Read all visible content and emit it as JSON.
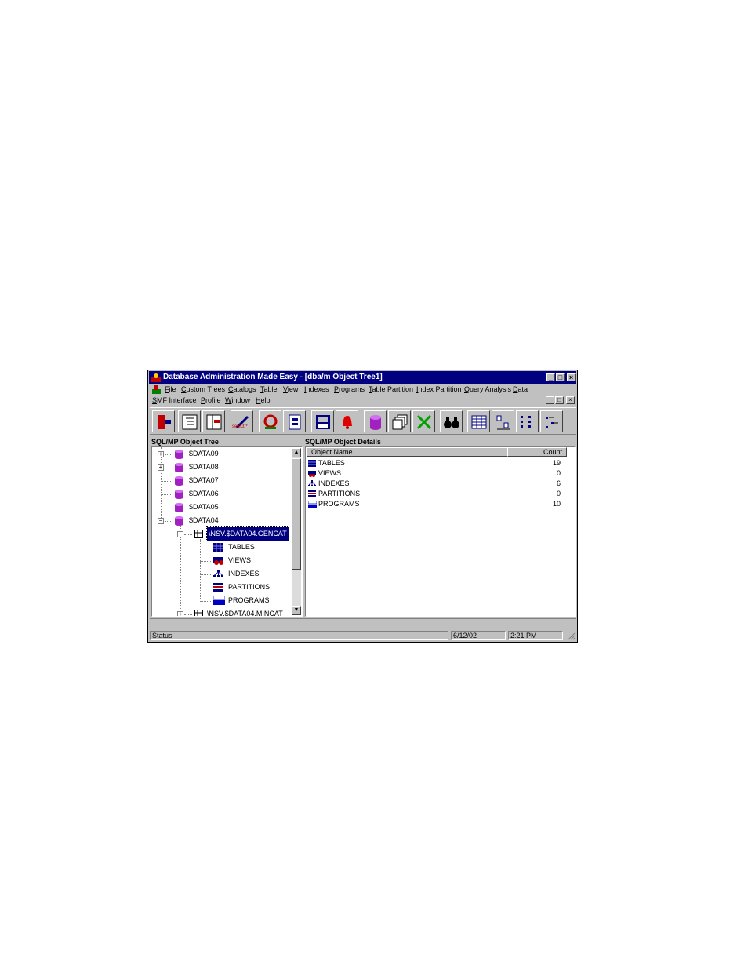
{
  "window": {
    "title": "Database Administration Made Easy - [dba/m Object Tree1]",
    "controls": {
      "minimize": "_",
      "maximize": "□",
      "close": "×"
    }
  },
  "menu": {
    "row1": [
      "File",
      "Custom Trees",
      "Catalogs",
      "Table",
      "View",
      "Indexes",
      "Programs",
      "Table Partition",
      "Index Partition",
      "Query Analysis",
      "Data"
    ],
    "row2": [
      "SMF Interface",
      "Profile",
      "Window",
      "Help"
    ]
  },
  "toolbar": {
    "icons": [
      "exit-icon",
      "tree-view-icon",
      "split-view-icon",
      "select-query-icon",
      "query-analysis-icon",
      "report-icon",
      "measure-icon",
      "alarm-bell-icon",
      "database-icon",
      "windows-icon",
      "cancel-icon",
      "find-binoculars-icon",
      "grid-icon",
      "small-icons-icon",
      "list-icon",
      "details-icon"
    ],
    "select_label": "select *"
  },
  "tree": {
    "header": "SQL/MP Object Tree",
    "items": [
      {
        "label": "$DATA09",
        "expander": "+"
      },
      {
        "label": "$DATA08",
        "expander": "+"
      },
      {
        "label": "$DATA07",
        "expander": ""
      },
      {
        "label": "$DATA06",
        "expander": ""
      },
      {
        "label": "$DATA05",
        "expander": ""
      },
      {
        "label": "$DATA04",
        "expander": "−"
      },
      {
        "label": "\\NSV.$DATA04.GENCAT",
        "expander": "−"
      },
      {
        "label": "TABLES",
        "expander": ""
      },
      {
        "label": "VIEWS",
        "expander": ""
      },
      {
        "label": "INDEXES",
        "expander": ""
      },
      {
        "label": "PARTITIONS",
        "expander": ""
      },
      {
        "label": "PROGRAMS",
        "expander": ""
      },
      {
        "label": "\\NSV.$DATA04.MINCAT",
        "expander": "+"
      }
    ],
    "scroll_up": "▲",
    "scroll_down": "▼"
  },
  "details": {
    "header": "SQL/MP Object Details",
    "columns": [
      "Object Name",
      "Count"
    ],
    "rows": [
      {
        "name": "TABLES",
        "count": "19"
      },
      {
        "name": "VIEWS",
        "count": "0"
      },
      {
        "name": "INDEXES",
        "count": "6"
      },
      {
        "name": "PARTITIONS",
        "count": "0"
      },
      {
        "name": "PROGRAMS",
        "count": "10"
      }
    ]
  },
  "status": {
    "text": "Status",
    "date": "6/12/02",
    "time": "2:21 PM"
  },
  "colors": {
    "titlebar": "#000080",
    "face": "#c0c0c0",
    "db_purple": "#a020c0"
  }
}
